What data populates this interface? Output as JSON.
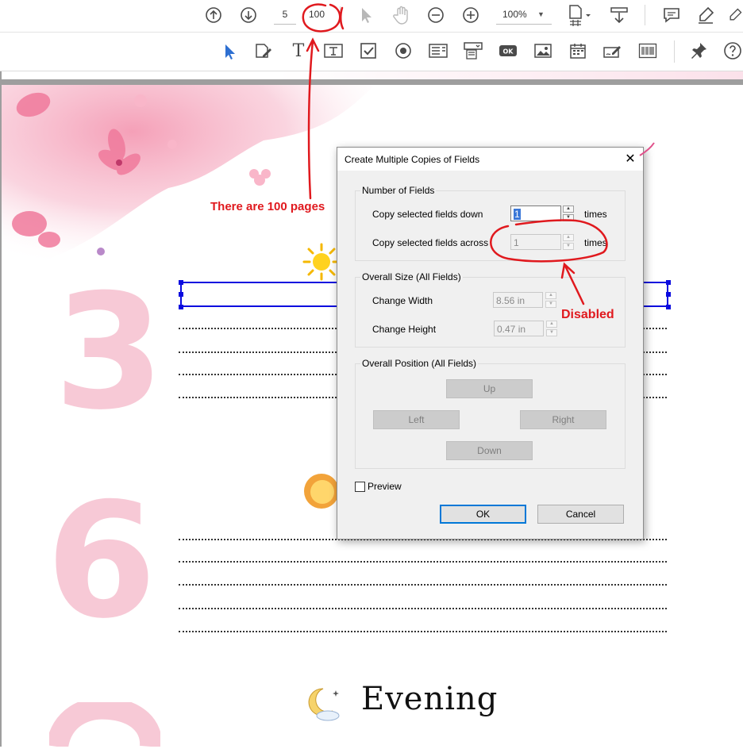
{
  "toolbar": {
    "current_page": "5",
    "total_pages": "100",
    "zoom": "100%"
  },
  "document": {
    "heading": "Evening",
    "numbers": [
      "3",
      "6"
    ]
  },
  "dialog": {
    "title": "Create Multiple Copies of Fields",
    "close": "✕",
    "number_of_fields": {
      "label": "Number of Fields",
      "down_label": "Copy selected fields down",
      "down_value": "1",
      "down_unit": "times",
      "across_label": "Copy selected fields across",
      "across_value": "1",
      "across_unit": "times"
    },
    "overall_size": {
      "label": "Overall Size (All Fields)",
      "width_label": "Change Width",
      "width_value": "8.56 in",
      "height_label": "Change Height",
      "height_value": "0.47 in"
    },
    "overall_position": {
      "label": "Overall Position (All Fields)",
      "up": "Up",
      "left": "Left",
      "right": "Right",
      "down": "Down"
    },
    "preview_label": "Preview",
    "ok_label": "OK",
    "cancel_label": "Cancel"
  },
  "annotations": {
    "pages_note": "There are 100 pages",
    "disabled_note": "Disabled",
    "color": "#e0191e"
  }
}
